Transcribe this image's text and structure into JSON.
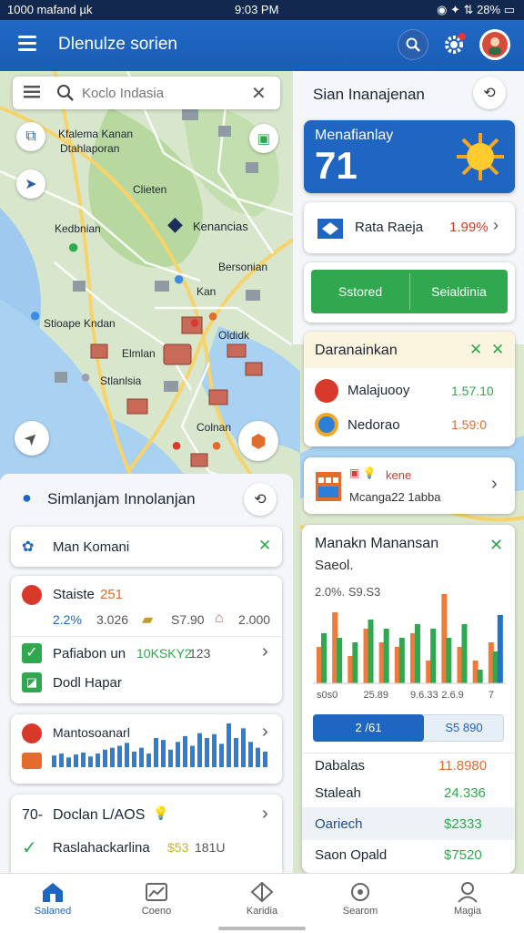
{
  "status": {
    "left": "1000 mafand µk",
    "time": "9:03 PM",
    "battery": "28%"
  },
  "app": {
    "title": "Dlenulze sorien"
  },
  "map": {
    "search_placeholder": "Koclo Indasia",
    "labels": [
      "Kfalema Kanan",
      "Dtahlaporan",
      "Clieten",
      "Kedbnian",
      "Kenancias",
      "Bersonian",
      "Kan",
      "Stioape Kndan",
      "Oldidk",
      "Elmlan",
      "Stlanlsia",
      "Colnan"
    ]
  },
  "right": {
    "header_title": "Sian Inanajenan",
    "weather": {
      "label": "Menafianlay",
      "value": "71"
    },
    "rate": {
      "label": "Rata Raeja",
      "value": "1.99%"
    },
    "buttons": {
      "left": "Sstored",
      "right": "Seialdinia"
    },
    "list1": {
      "title": "Daranainkan",
      "items": [
        {
          "label": "Malajuooy",
          "value": "1.57.10"
        },
        {
          "label": "Nedorao",
          "value": "1.59:0"
        }
      ]
    },
    "promo": {
      "title": "kene",
      "subtitle": "Mcanga22 1abba"
    },
    "chart_card": {
      "title": "Manakn Manansan",
      "subtitle": "Saeol.",
      "stat": "2.0%. S9.S3"
    },
    "segment": {
      "left": "2 /61",
      "right": "S5 890"
    },
    "table": [
      {
        "label": "Dabalas",
        "value": "11.8980"
      },
      {
        "label": "Staleah",
        "value": "24.336"
      },
      {
        "label": "Oariech",
        "value": "$2333"
      },
      {
        "label": "Saon Opald",
        "value": "$7520"
      }
    ]
  },
  "left": {
    "panel_title": "Simlanjam Innolanjan",
    "filter": "Man Komani",
    "stats": {
      "title": "Staiste",
      "title_value": "251",
      "pct": "2.2%",
      "v1": "3.026",
      "v2": "S7.90",
      "v3": "2.000"
    },
    "check1": {
      "label": "Pafiabon un",
      "value": "10KSKY2",
      "extra": "123"
    },
    "check2": {
      "label": "Dodl Hapar"
    },
    "mini_chart": {
      "title": "Mantosoanarl"
    },
    "bottom": {
      "prefix": "70-",
      "title": "Doclan L/AOS",
      "row_label": "Raslahackarlina",
      "row_value": "$53",
      "row_extra": "181U"
    }
  },
  "nav": [
    "Salaned",
    "Coeno",
    "Karidia",
    "Searom",
    "Magia"
  ],
  "chart_data": {
    "type": "bar",
    "title": "Manakn Manansan",
    "categories": [
      "s0s0",
      "",
      "",
      "25.89",
      "",
      "",
      "9.6.33",
      "",
      "2.6.9",
      "",
      "",
      "7"
    ],
    "series": [
      {
        "color": "#f07a3a",
        "values": [
          40,
          78,
          30,
          60,
          45,
          40,
          55,
          25,
          98,
          40,
          25,
          45
        ]
      },
      {
        "color": "#2fa84f",
        "values": [
          55,
          50,
          45,
          70,
          60,
          50,
          65,
          60,
          50,
          65,
          15,
          35
        ]
      },
      {
        "color": "#2471c8",
        "values": [
          0,
          0,
          0,
          0,
          0,
          0,
          0,
          0,
          0,
          0,
          0,
          75
        ]
      }
    ],
    "x_ticks": [
      "s0s0",
      "25.89",
      "9.6.33",
      "2.6.9",
      "7"
    ],
    "ylim": [
      0,
      100
    ]
  },
  "mini_chart_data": {
    "type": "bar",
    "values": [
      12,
      14,
      10,
      13,
      15,
      11,
      14,
      18,
      20,
      22,
      25,
      16,
      20,
      14,
      30,
      28,
      18,
      26,
      32,
      22,
      35,
      30,
      34,
      24,
      45,
      30,
      40,
      26,
      20,
      16
    ]
  }
}
